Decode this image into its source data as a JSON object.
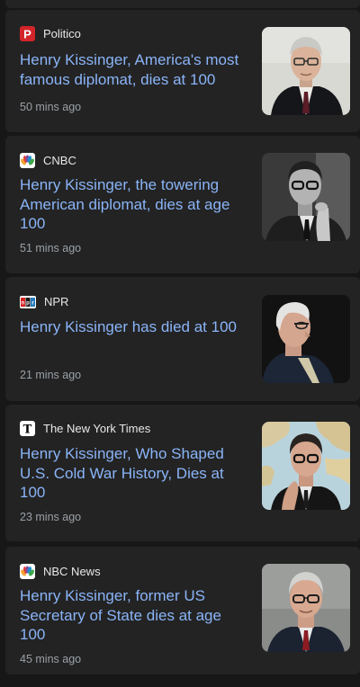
{
  "articles": [
    {
      "source": "Politico",
      "source_icon": "politico-logo-icon",
      "headline": "Henry Kissinger, America's most famous diplomat, dies at 100",
      "time": "50 mins ago",
      "thumbnail": "kissinger-portrait-color"
    },
    {
      "source": "CNBC",
      "source_icon": "cnbc-peacock-logo-icon",
      "headline": "Henry Kissinger, the towering American diplomat, dies at age 100",
      "time": "51 mins ago",
      "thumbnail": "kissinger-portrait-bw"
    },
    {
      "source": "NPR",
      "source_icon": "npr-logo-icon",
      "headline": "Henry Kissinger has died at 100",
      "time": "21 mins ago",
      "thumbnail": "kissinger-profile-elderly"
    },
    {
      "source": "The New York Times",
      "source_icon": "nyt-logo-icon",
      "headline": "Henry Kissinger, Who Shaped U.S. Cold War History, Dies at 100",
      "time": "23 mins ago",
      "thumbnail": "kissinger-with-globe"
    },
    {
      "source": "NBC News",
      "source_icon": "nbc-peacock-logo-icon",
      "headline": "Henry Kissinger, former US Secretary of State dies at age 100",
      "time": "45 mins ago",
      "thumbnail": "kissinger-portrait-older"
    }
  ],
  "colors": {
    "background": "#171717",
    "card": "#232323",
    "headline": "#8ab4f8",
    "source_text": "#e8e8e8",
    "time_text": "#9aa0a6",
    "politico_red": "#d3242a"
  }
}
